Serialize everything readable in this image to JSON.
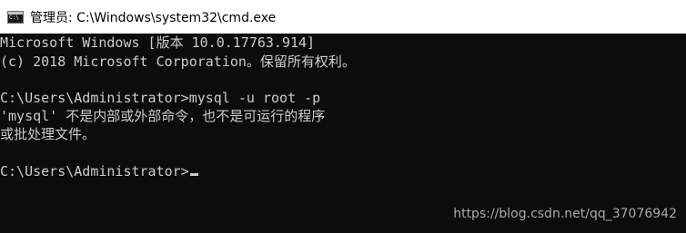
{
  "window": {
    "title": "管理员: C:\\Windows\\system32\\cmd.exe",
    "icon": "cmd-icon",
    "icon_text": "C:\\"
  },
  "console": {
    "lines": [
      "Microsoft Windows [版本 10.0.17763.914]",
      "(c) 2018 Microsoft Corporation。保留所有权利。",
      "",
      "C:\\Users\\Administrator>mysql -u root -p",
      "'mysql' 不是内部或外部命令，也不是可运行的程序",
      "或批处理文件。",
      "",
      "C:\\Users\\Administrator>"
    ]
  },
  "watermark": "https://blog.csdn.net/qq_37076942",
  "colors": {
    "background": "#0c0c0c",
    "text": "#cccccc",
    "titlebar": "#ffffff"
  }
}
